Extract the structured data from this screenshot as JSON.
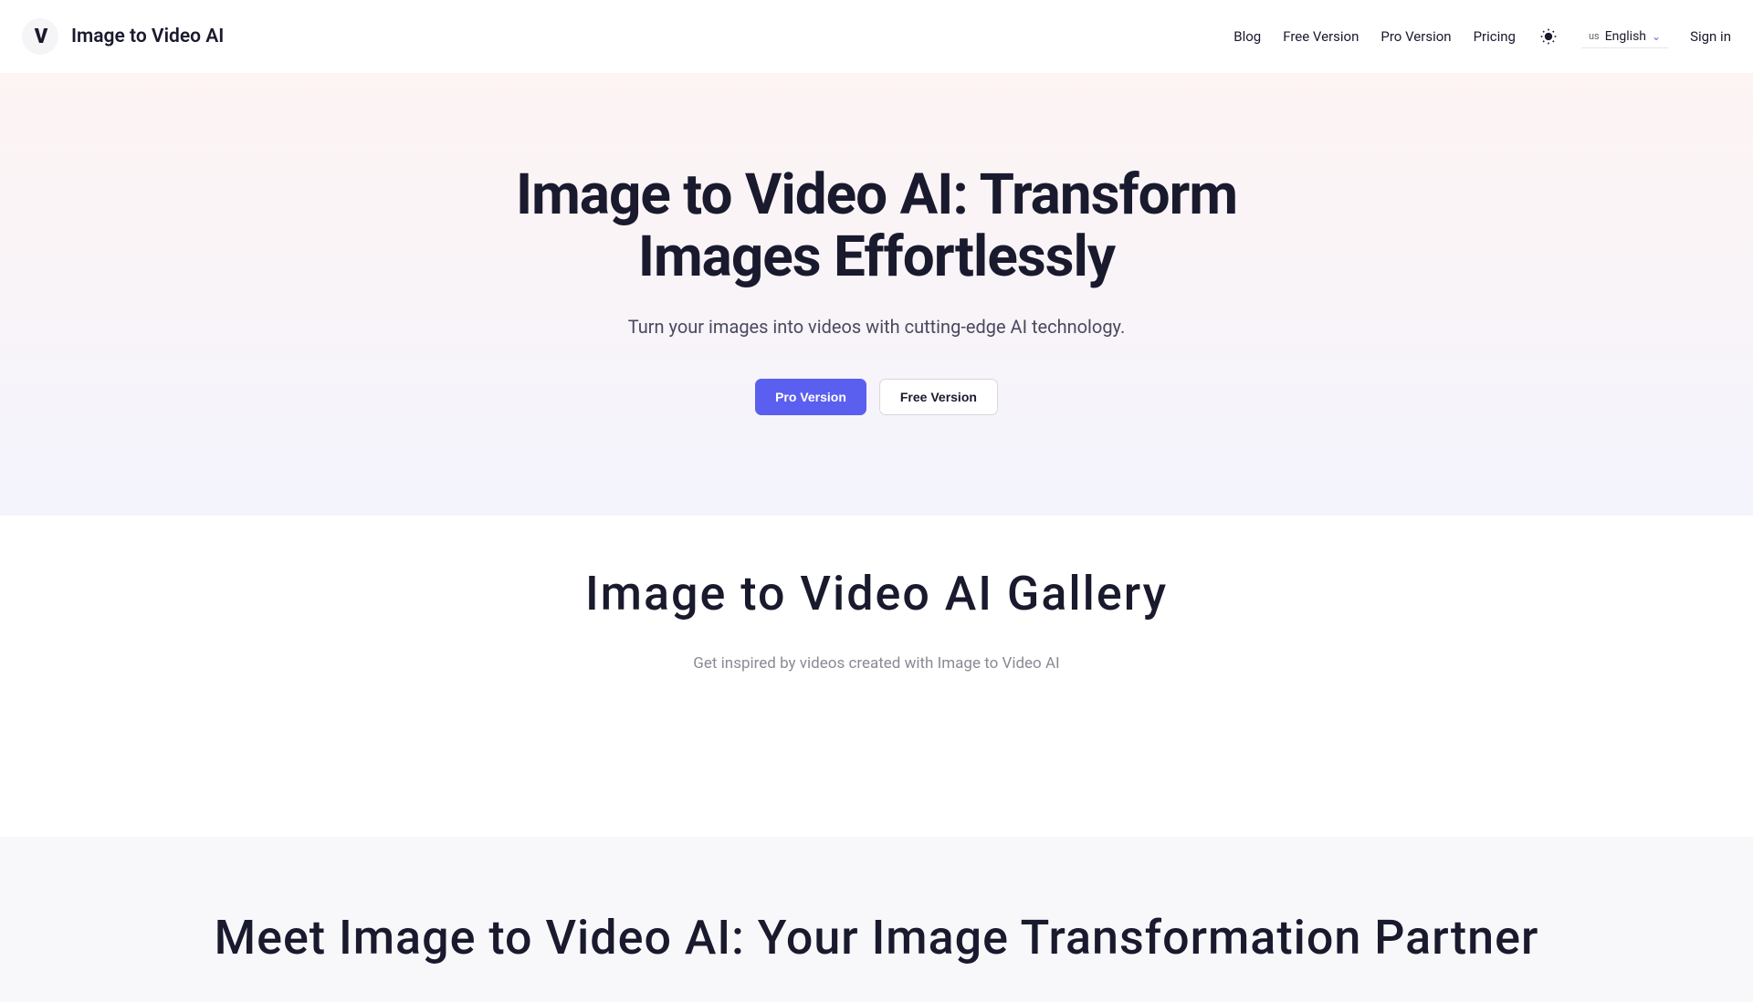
{
  "header": {
    "logo_text": "Image to Video AI",
    "nav": {
      "blog": "Blog",
      "free_version": "Free Version",
      "pro_version": "Pro Version",
      "pricing": "Pricing"
    },
    "language": {
      "prefix": "us",
      "label": "English"
    },
    "sign_in": "Sign in"
  },
  "hero": {
    "title": "Image to Video AI: Transform Images Effortlessly",
    "subtitle": "Turn your images into videos with cutting-edge AI technology.",
    "buttons": {
      "pro": "Pro Version",
      "free": "Free Version"
    }
  },
  "gallery": {
    "title": "Image to Video AI Gallery",
    "subtitle": "Get inspired by videos created with Image to Video AI"
  },
  "partner": {
    "title": "Meet Image to Video AI: Your Image Transformation Partner"
  }
}
